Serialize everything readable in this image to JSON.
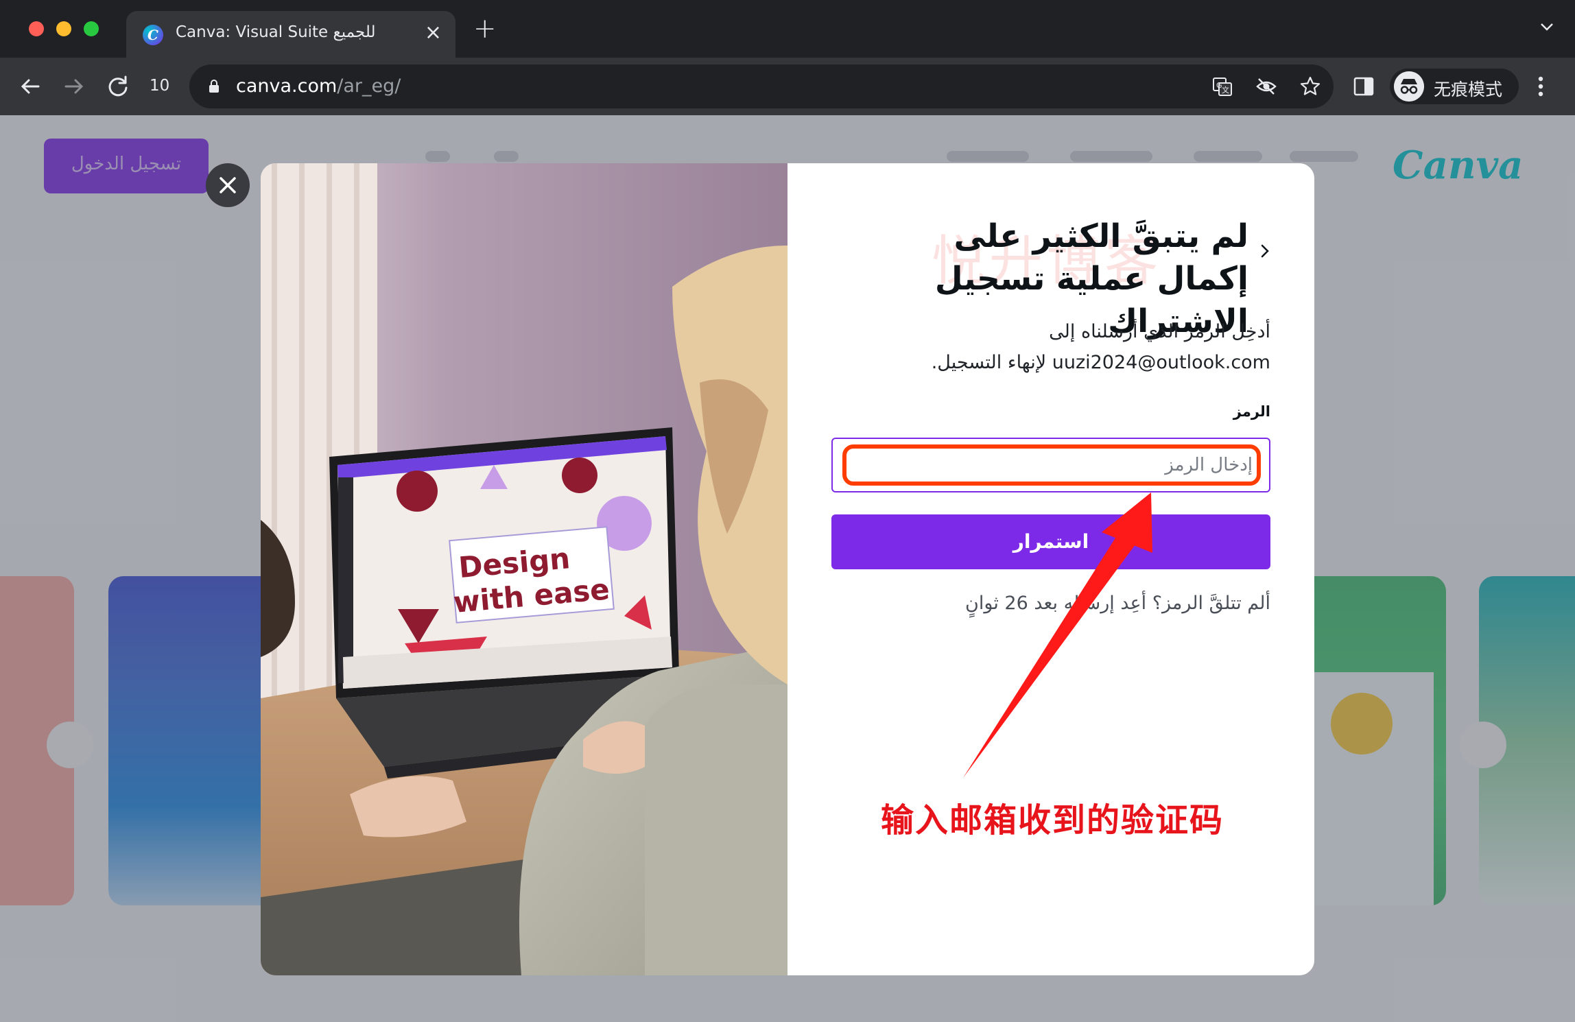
{
  "browser": {
    "tab_title": "Canva: Visual Suite للجميع",
    "tab_favicon_letter": "C",
    "tab_count": "10",
    "url_host": "canva.com",
    "url_path": "/ar_eg/",
    "incognito_label": "无痕模式"
  },
  "background_page": {
    "login_button_label": "تسجيل الدخول",
    "logo_text": "Canva"
  },
  "modal": {
    "title": "لم يتبقَّ الكثير على إكمال عملية تسجيل الاشتراك",
    "watermark": "悦升博客",
    "description": "أدخِل الرمز الذي أرسلناه إلى uuzi2024@outlook.com لإنهاء التسجيل.",
    "code_label": "الرمز",
    "code_placeholder": "إدخال الرمز",
    "code_value": "",
    "continue_label": "استمرار",
    "resend_text": "ألم تتلقَّ الرمز؟ أعِد إرساله بعد 26 ثوانٍ",
    "photo_laptop_text_1": "Design",
    "photo_laptop_text_2": "with ease"
  },
  "annotation": {
    "text": "输入邮箱收到的验证码",
    "color": "#e8141c"
  },
  "colors": {
    "brand_purple": "#7d2ae8",
    "highlight_orange": "#ff3d00"
  }
}
